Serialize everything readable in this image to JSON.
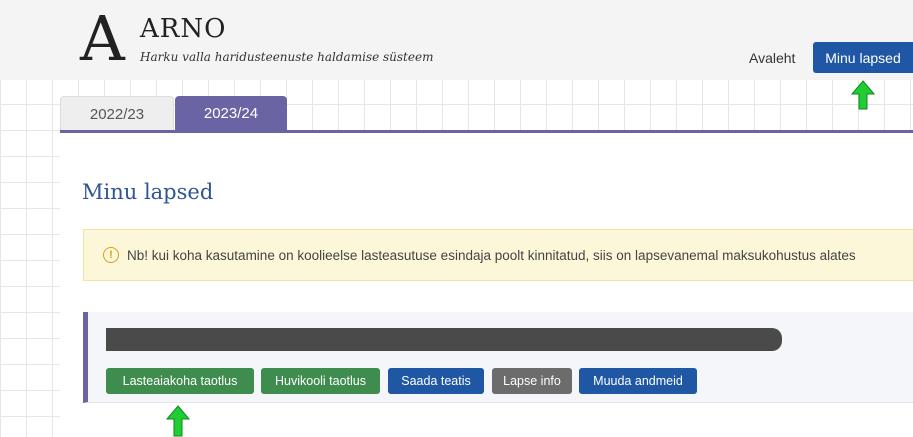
{
  "header": {
    "logo_letter": "A",
    "logo_name": "ARNO",
    "logo_subtitle": "Harku valla haridusteenuste haldamise süsteem",
    "nav": {
      "home": "Avaleht",
      "active": "Minu lapsed"
    }
  },
  "tabs": [
    {
      "label": "2022/23",
      "active": false
    },
    {
      "label": "2023/24",
      "active": true
    }
  ],
  "main": {
    "title": "Minu lapsed",
    "notice": {
      "icon": "exclamation-circle-icon",
      "text": "Nb! kui koha kasutamine on koolieelse lasteasutuse esindaja poolt kinnitatud, siis on lapsevanemal maksukohustus alates"
    },
    "child": {
      "buttons": [
        {
          "label": "Lasteaiakoha taotlus",
          "style": "green"
        },
        {
          "label": "Huvikooli taotlus",
          "style": "green"
        },
        {
          "label": "Saada teatis",
          "style": "blue"
        },
        {
          "label": "Lapse info",
          "style": "gray"
        },
        {
          "label": "Muuda andmeid",
          "style": "blue"
        }
      ]
    }
  },
  "annotations": {
    "arrow_color": "#22cc33",
    "arrow_icon": "up-arrow-icon"
  },
  "colors": {
    "primary_blue": "#1f57a4",
    "tab_purple": "#6b64a4",
    "button_green": "#3f8d4e",
    "button_gray": "#6c6c6c",
    "title_blue": "#2f5592",
    "notice_bg": "#fdf7d9"
  }
}
